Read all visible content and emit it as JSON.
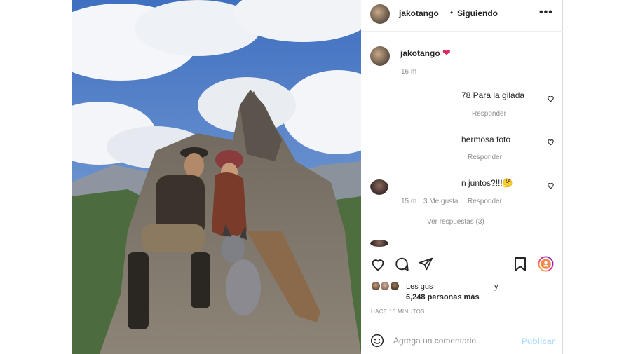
{
  "post": {
    "header": {
      "username": "jakotango",
      "separator": "•",
      "follow_status": "Siguiendo",
      "more_label": "•••"
    },
    "caption": {
      "username": "jakotango",
      "emoji": "❤",
      "time": "16 m"
    },
    "comments": [
      {
        "text": "78 Para la gilada",
        "reply_label": "Responder"
      },
      {
        "text": "hermosa foto",
        "reply_label": "Responder"
      },
      {
        "text": "n juntos?!!!🤔",
        "time": "15 m",
        "likes": "3 Me gusta",
        "reply_label": "Responder",
        "view_replies": "Ver respuestas (3)"
      }
    ],
    "likes": {
      "prefix": "Les gus",
      "connector": "y",
      "count_text": "6,248 personas más"
    },
    "posted_ago": "HACE 16 MINUTOS",
    "add_comment": {
      "placeholder": "Agrega un comentario...",
      "publish_label": "Publicar"
    }
  },
  "colors": {
    "heart": "#e0245e",
    "muted": "#8e8e8e",
    "publish_disabled": "#b2dffc",
    "text": "#262626"
  }
}
